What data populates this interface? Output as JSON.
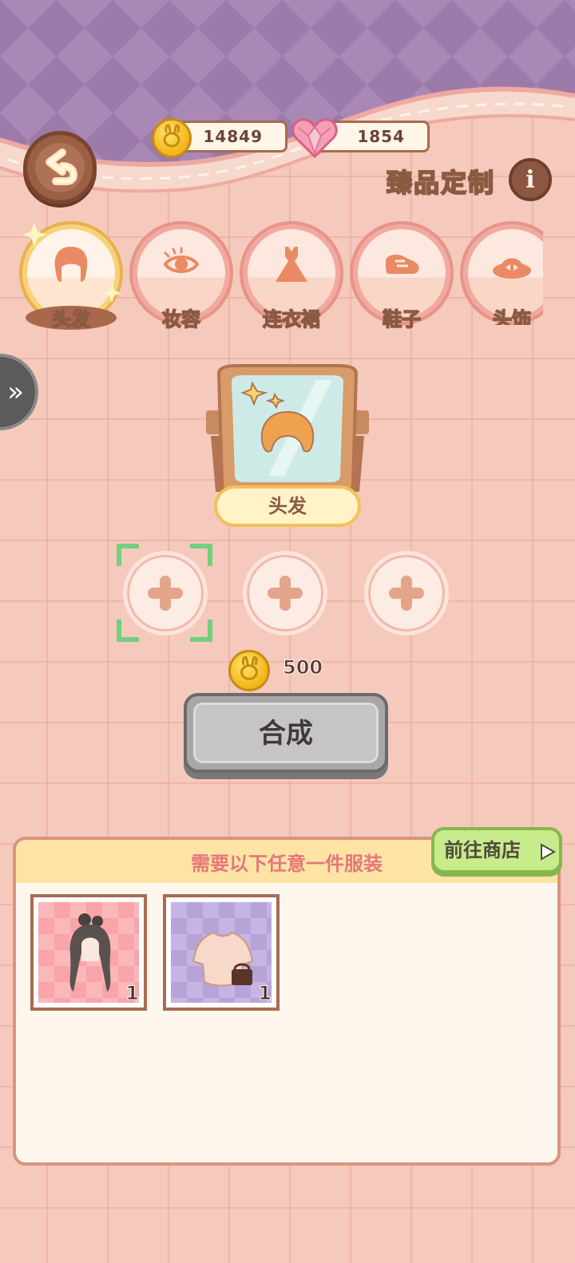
{
  "currency": {
    "coins": "14849",
    "hearts": "1854"
  },
  "header": {
    "title": "臻品定制",
    "info_icon": "i"
  },
  "tabs": [
    {
      "label": "头发",
      "icon": "hair-icon",
      "active": true
    },
    {
      "label": "妆容",
      "icon": "eye-icon",
      "active": false
    },
    {
      "label": "连衣裙",
      "icon": "dress-icon",
      "active": false
    },
    {
      "label": "鞋子",
      "icon": "shoe-icon",
      "active": false
    },
    {
      "label": "头饰",
      "icon": "hat-icon",
      "active": false
    }
  ],
  "mirror": {
    "label": "头发"
  },
  "cost": {
    "amount": "500"
  },
  "synth_button": {
    "label": "合成"
  },
  "panel": {
    "title": "需要以下任意一件服装",
    "shop_button": "前往商店",
    "items": [
      {
        "count": "1",
        "bg": "pink",
        "icon": "long-hair-icon"
      },
      {
        "count": "1",
        "bg": "purple",
        "icon": "top-with-bag-icon"
      }
    ]
  },
  "colors": {
    "accent": "#f2a9a0",
    "bg": "#f5c9bb",
    "coin": "#f2b418",
    "confirm": "#72d07e"
  }
}
